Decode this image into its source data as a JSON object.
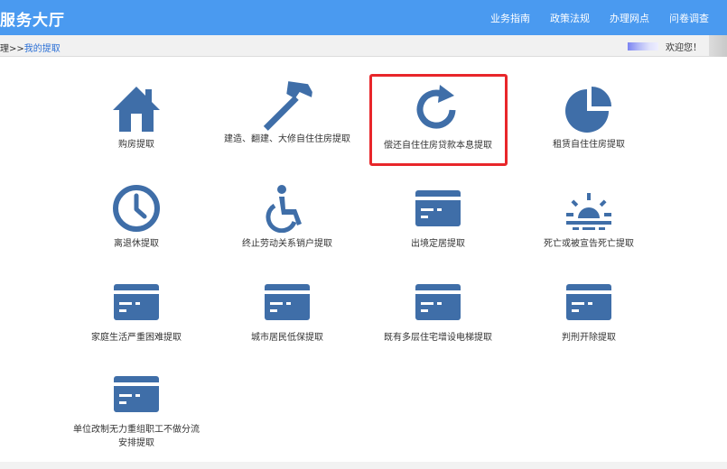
{
  "header": {
    "title": "服务大厅",
    "nav": [
      "业务指南",
      "政策法规",
      "办理网点",
      "问卷调查"
    ]
  },
  "breadcrumb": {
    "prefix": "理>>",
    "current": "我的提取"
  },
  "user": {
    "welcome": "欢迎您！"
  },
  "items": [
    {
      "label": "购房提取",
      "icon": "house-icon"
    },
    {
      "label": "建造、翻建、大修自住住房提取",
      "icon": "hammer-icon"
    },
    {
      "label": "偿还自住住房贷款本息提取",
      "icon": "refresh-icon"
    },
    {
      "label": "租赁自住住房提取",
      "icon": "pie-chart-icon"
    },
    {
      "label": "离退休提取",
      "icon": "clock-icon"
    },
    {
      "label": "终止劳动关系销户提取",
      "icon": "wheelchair-icon"
    },
    {
      "label": "出境定居提取",
      "icon": "card-icon"
    },
    {
      "label": "死亡或被宣告死亡提取",
      "icon": "sunset-icon"
    },
    {
      "label": "家庭生活严重困难提取",
      "icon": "card-icon"
    },
    {
      "label": "城市居民低保提取",
      "icon": "card-icon"
    },
    {
      "label": "既有多层住宅增设电梯提取",
      "icon": "card-icon"
    },
    {
      "label": "判刑开除提取",
      "icon": "card-icon"
    },
    {
      "label": "单位改制无力重组职工不做分流安排提取",
      "icon": "card-icon"
    }
  ],
  "colors": {
    "header": "#4a9af0",
    "icon": "#3f6ea8",
    "highlight": "#e8262a"
  }
}
